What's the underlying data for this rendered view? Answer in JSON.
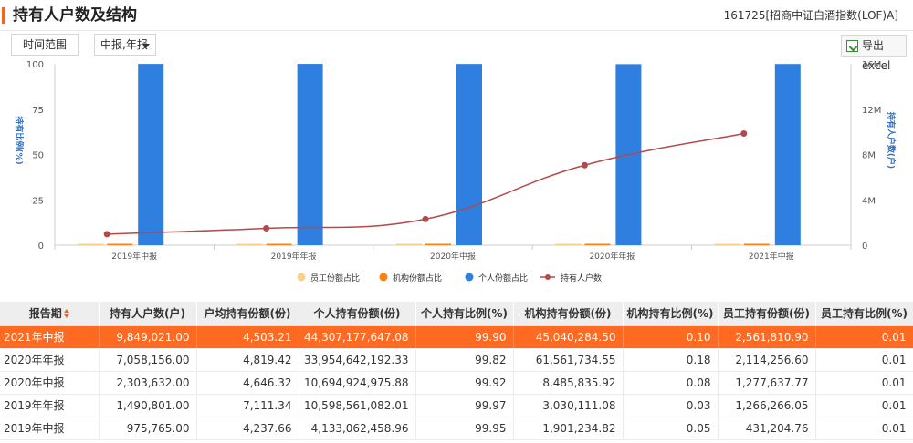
{
  "header": {
    "title": "持有人户数及结构",
    "fund": "161725[招商中证白酒指数(LOF)A]"
  },
  "toolbar": {
    "range_label": "时间范围",
    "period_label": "中报,年报",
    "export_label": "导出excel"
  },
  "colors": {
    "accent": "#f26522",
    "bar_personal": "#2e7fe0",
    "bar_employee": "#f7d18a",
    "bar_institution": "#ff7f0e",
    "line_holders": "#b5484a",
    "row_highlight": "#ff6a22"
  },
  "chart_data": {
    "type": "bar",
    "categories": [
      "2019年中报",
      "2019年年报",
      "2020年中报",
      "2020年年报",
      "2021年中报"
    ],
    "ylabel": "持有比例(%)",
    "y2label": "持有人户数(户)",
    "ylim": [
      0,
      100
    ],
    "y2lim": [
      0,
      16000000
    ],
    "yticks": [
      "0",
      "25",
      "50",
      "75",
      "100"
    ],
    "y2ticks": [
      "0",
      "4M",
      "8M",
      "12M",
      "16M"
    ],
    "series": [
      {
        "name": "员工份额占比",
        "kind": "bar",
        "values": [
          0.01,
          0.01,
          0.01,
          0.01,
          0.01
        ]
      },
      {
        "name": "机构份额占比",
        "kind": "bar",
        "values": [
          0.05,
          0.03,
          0.08,
          0.18,
          0.1
        ]
      },
      {
        "name": "个人份额占比",
        "kind": "bar",
        "values": [
          99.95,
          99.97,
          99.92,
          99.82,
          99.9
        ]
      },
      {
        "name": "持有人户数",
        "kind": "line",
        "axis": "right",
        "values": [
          975765,
          1490801,
          2303632,
          7058156,
          9849021
        ]
      }
    ],
    "legend_position": "bottom",
    "grid": false
  },
  "table": {
    "headers": [
      "报告期",
      "持有人户数(户)",
      "户均持有份额(份)",
      "个人持有份额(份)",
      "个人持有比例(%)",
      "机构持有份额(份)",
      "机构持有比例(%)",
      "员工持有份额(份)",
      "员工持有比例(%)"
    ],
    "rows": [
      [
        "2021年中报",
        "9,849,021.00",
        "4,503.21",
        "44,307,177,647.08",
        "99.90",
        "45,040,284.50",
        "0.10",
        "2,561,810.90",
        "0.01"
      ],
      [
        "2020年年报",
        "7,058,156.00",
        "4,819.42",
        "33,954,642,192.33",
        "99.82",
        "61,561,734.55",
        "0.18",
        "2,114,256.60",
        "0.01"
      ],
      [
        "2020年中报",
        "2,303,632.00",
        "4,646.32",
        "10,694,924,975.88",
        "99.92",
        "8,485,835.92",
        "0.08",
        "1,277,637.77",
        "0.01"
      ],
      [
        "2019年年报",
        "1,490,801.00",
        "7,111.34",
        "10,598,561,082.01",
        "99.97",
        "3,030,111.08",
        "0.03",
        "1,266,266.05",
        "0.01"
      ],
      [
        "2019年中报",
        "975,765.00",
        "4,237.66",
        "4,133,062,458.96",
        "99.95",
        "1,901,234.82",
        "0.05",
        "431,204.76",
        "0.01"
      ]
    ]
  }
}
